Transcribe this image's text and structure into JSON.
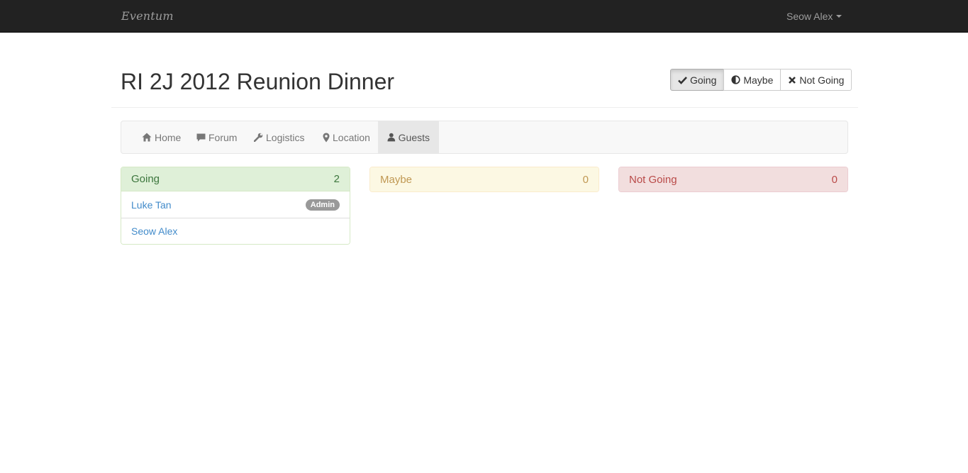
{
  "navbar": {
    "brand": "Eventum",
    "user": "Seow Alex"
  },
  "event": {
    "title": "RI 2J 2012 Reunion Dinner"
  },
  "rsvp": {
    "going_label": "Going",
    "maybe_label": "Maybe",
    "not_going_label": "Not Going",
    "selected": "Going"
  },
  "tabs": [
    {
      "label": "Home",
      "icon": "home-icon"
    },
    {
      "label": "Forum",
      "icon": "comment-icon"
    },
    {
      "label": "Logistics",
      "icon": "wrench-icon"
    },
    {
      "label": "Location",
      "icon": "map-marker-icon"
    },
    {
      "label": "Guests",
      "icon": "user-icon",
      "active": true
    }
  ],
  "guests": {
    "going": {
      "label": "Going",
      "count": "2",
      "list": [
        {
          "name": "Luke Tan",
          "badge": "Admin"
        },
        {
          "name": "Seow Alex"
        }
      ]
    },
    "maybe": {
      "label": "Maybe",
      "count": "0"
    },
    "not_going": {
      "label": "Not Going",
      "count": "0"
    }
  },
  "colors": {
    "navbar_bg": "#222222",
    "link": "#428bca",
    "success_bg": "#dff0d8",
    "warning_bg": "#fcf8e3",
    "danger_bg": "#f2dede"
  }
}
